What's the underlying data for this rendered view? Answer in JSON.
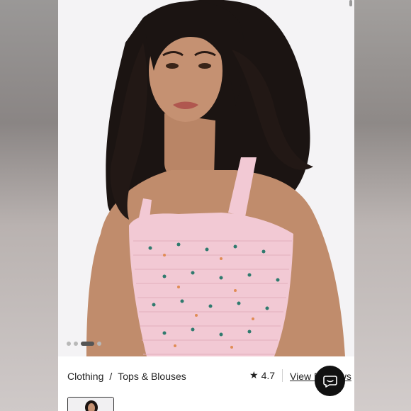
{
  "product": {
    "image_alt": "Model wearing pink smocked top",
    "carousel": {
      "total": 4,
      "active": 2
    }
  },
  "breadcrumb": {
    "category": "Clothing",
    "separator": "/",
    "subcategory": "Tops & Blouses"
  },
  "rating": {
    "star_icon": "★",
    "value": "4.7"
  },
  "view_link": "View Reviews",
  "chat": {
    "icon": "chat-bubble-icon"
  },
  "colors": {
    "top_pink": "#f2c9d4",
    "chat_bg": "#111111",
    "text": "#222222"
  }
}
